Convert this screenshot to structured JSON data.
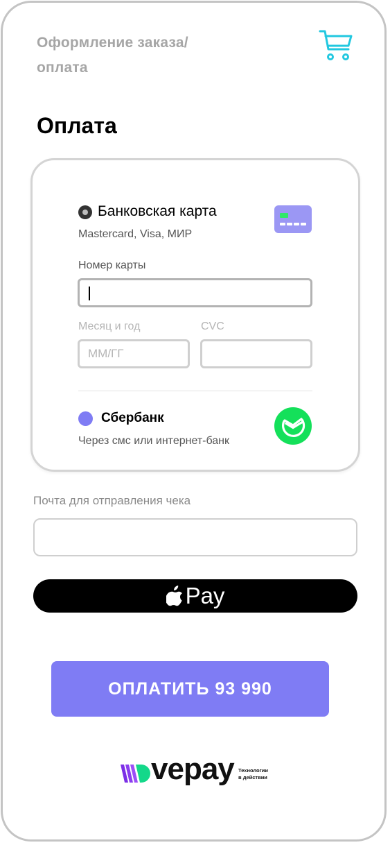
{
  "header": {
    "breadcrumb_line1": "Оформление заказа/",
    "breadcrumb_line2": "оплата",
    "cart_icon": "shopping-cart-icon"
  },
  "page": {
    "title": "Оплата"
  },
  "payment_methods": {
    "bank_card": {
      "title": "Банковская карта",
      "subtitle": "Mastercard, Visa, МИР",
      "selected": true,
      "icon": "credit-card-icon"
    },
    "card_number": {
      "label": "Номер карты",
      "value": ""
    },
    "expiry": {
      "label": "Месяц и год",
      "placeholder": "ММ/ГГ",
      "value": ""
    },
    "cvc": {
      "label": "CVC",
      "value": ""
    },
    "sberbank": {
      "title": "Сбербанк",
      "subtitle": "Через смс или интернет-банк",
      "selected": false,
      "icon": "sberbank-logo-icon"
    }
  },
  "email": {
    "label": "Почта для отправления чека",
    "value": ""
  },
  "apple_pay": {
    "label": "Pay",
    "icon": "apple-logo-icon"
  },
  "pay_button": {
    "label": "ОПЛАТИТЬ 93 990"
  },
  "footer": {
    "brand": "vepay",
    "tagline_line1": "Технологии",
    "tagline_line2": "в действии"
  },
  "colors": {
    "accent": "#7f7cf4",
    "cart": "#22c8e0",
    "sber_green": "#14e05a",
    "frame_border": "#c4c4c4"
  }
}
